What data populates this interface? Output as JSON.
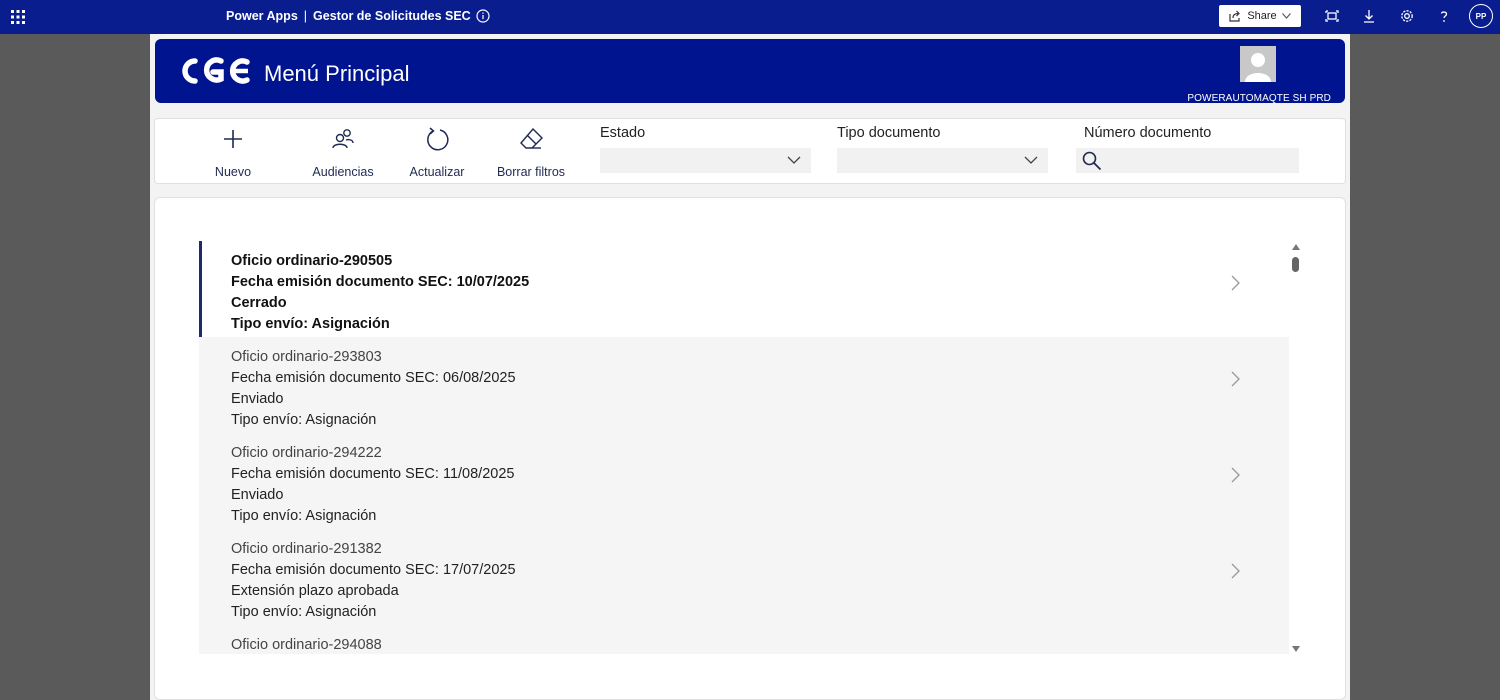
{
  "topbar": {
    "app_name": "Power Apps",
    "separator": "|",
    "app_title": "Gestor de Solicitudes SEC",
    "share_label": "Share",
    "user_initials": "PP",
    "icons": [
      "waffle-icon",
      "info-icon",
      "share-icon",
      "chevron-down-icon",
      "fit-screen-icon",
      "download-icon",
      "gear-icon",
      "help-icon"
    ],
    "bar_color": "#0a1d8f"
  },
  "header": {
    "logo_text": "CGE",
    "title": "Menú Principal",
    "user_label": "POWERAUTOMAQTE SH PRD",
    "color": "#00148f"
  },
  "toolbar": {
    "buttons": [
      {
        "label": "Nuevo",
        "icon": "plus-icon"
      },
      {
        "label": "Audiencias",
        "icon": "people-icon"
      },
      {
        "label": "Actualizar",
        "icon": "refresh-icon"
      },
      {
        "label": "Borrar filtros",
        "icon": "eraser-icon"
      }
    ],
    "filters": {
      "estado_label": "Estado",
      "estado_value": "",
      "tipo_label": "Tipo documento",
      "tipo_value": "",
      "numero_label": "Número documento",
      "numero_value": ""
    }
  },
  "list": {
    "items": [
      {
        "title": "Oficio ordinario-290505",
        "fecha": "Fecha emisión documento SEC: 10/07/2025",
        "estado": "Cerrado",
        "tipo": "Tipo envío: Asignación",
        "selected": true
      },
      {
        "title": "Oficio ordinario-293803",
        "fecha": "Fecha emisión documento SEC: 06/08/2025",
        "estado": "Enviado",
        "tipo": "Tipo envío: Asignación",
        "selected": false
      },
      {
        "title": "Oficio ordinario-294222",
        "fecha": "Fecha emisión documento SEC: 11/08/2025",
        "estado": "Enviado",
        "tipo": "Tipo envío: Asignación",
        "selected": false
      },
      {
        "title": "Oficio ordinario-291382",
        "fecha": "Fecha emisión documento SEC: 17/07/2025",
        "estado": "Extensión plazo aprobada",
        "tipo": "Tipo envío: Asignación",
        "selected": false
      },
      {
        "title": "Oficio ordinario-294088",
        "fecha": "",
        "estado": "",
        "tipo": "",
        "selected": false
      }
    ]
  }
}
